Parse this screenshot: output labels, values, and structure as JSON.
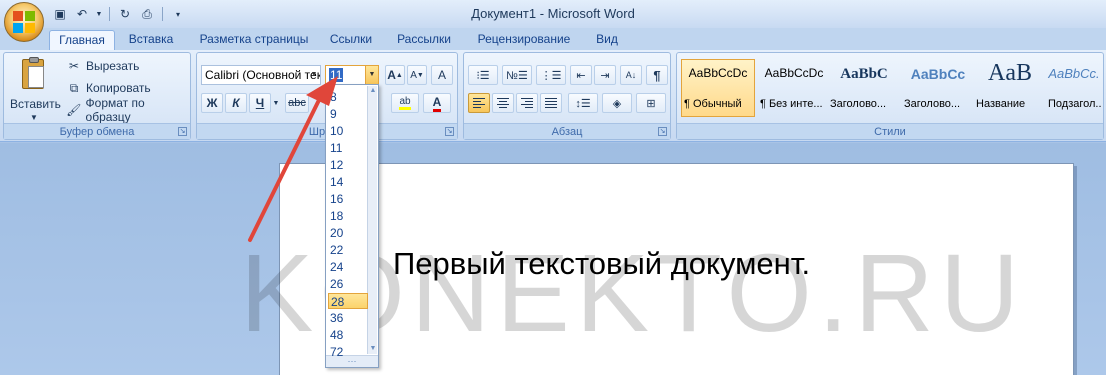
{
  "window": {
    "title": "Документ1 - Microsoft Word"
  },
  "quick_access": [
    {
      "icon": "save-icon"
    },
    {
      "icon": "undo-icon"
    },
    {
      "icon": "redo-icon"
    },
    {
      "icon": "print-preview-icon"
    },
    {
      "icon": "customize-dropdown-icon"
    }
  ],
  "tabs": [
    {
      "label": "Главная",
      "active": true
    },
    {
      "label": "Вставка"
    },
    {
      "label": "Разметка страницы"
    },
    {
      "label": "Ссылки"
    },
    {
      "label": "Рассылки"
    },
    {
      "label": "Рецензирование"
    },
    {
      "label": "Вид"
    }
  ],
  "clipboard": {
    "group_label": "Буфер обмена",
    "paste_label": "Вставить",
    "cut_label": "Вырезать",
    "copy_label": "Копировать",
    "format_painter_label": "Формат по образцу"
  },
  "font": {
    "group_label": "Шрифт",
    "font_name": "Calibri (Основной текст)",
    "font_size": "11",
    "bold": "Ж",
    "italic": "К",
    "underline": "Ч",
    "strike": "abc",
    "grow": "A",
    "shrink": "A",
    "clear": "A"
  },
  "paragraph": {
    "group_label": "Абзац"
  },
  "styles": {
    "group_label": "Стили",
    "items": [
      {
        "preview": "AaBbCcDc",
        "name": "¶ Обычный",
        "selected": true
      },
      {
        "preview": "AaBbCcDc",
        "name": "¶ Без инте..."
      },
      {
        "preview": "AaBbC",
        "name": "Заголово..."
      },
      {
        "preview": "AaBbCc",
        "name": "Заголово..."
      },
      {
        "preview": "AaB",
        "name": "Название"
      },
      {
        "preview": "AaBbCc.",
        "name": "Подзагол..."
      }
    ]
  },
  "font_size_list": {
    "items": [
      "8",
      "9",
      "10",
      "11",
      "12",
      "14",
      "16",
      "18",
      "20",
      "22",
      "24",
      "26",
      "28",
      "36",
      "48",
      "72"
    ],
    "highlighted": "28"
  },
  "document": {
    "text": "Первый текстовый документ."
  },
  "watermark": {
    "text": "KONEKTO.RU"
  },
  "annotation": {
    "color": "#e0463a"
  }
}
